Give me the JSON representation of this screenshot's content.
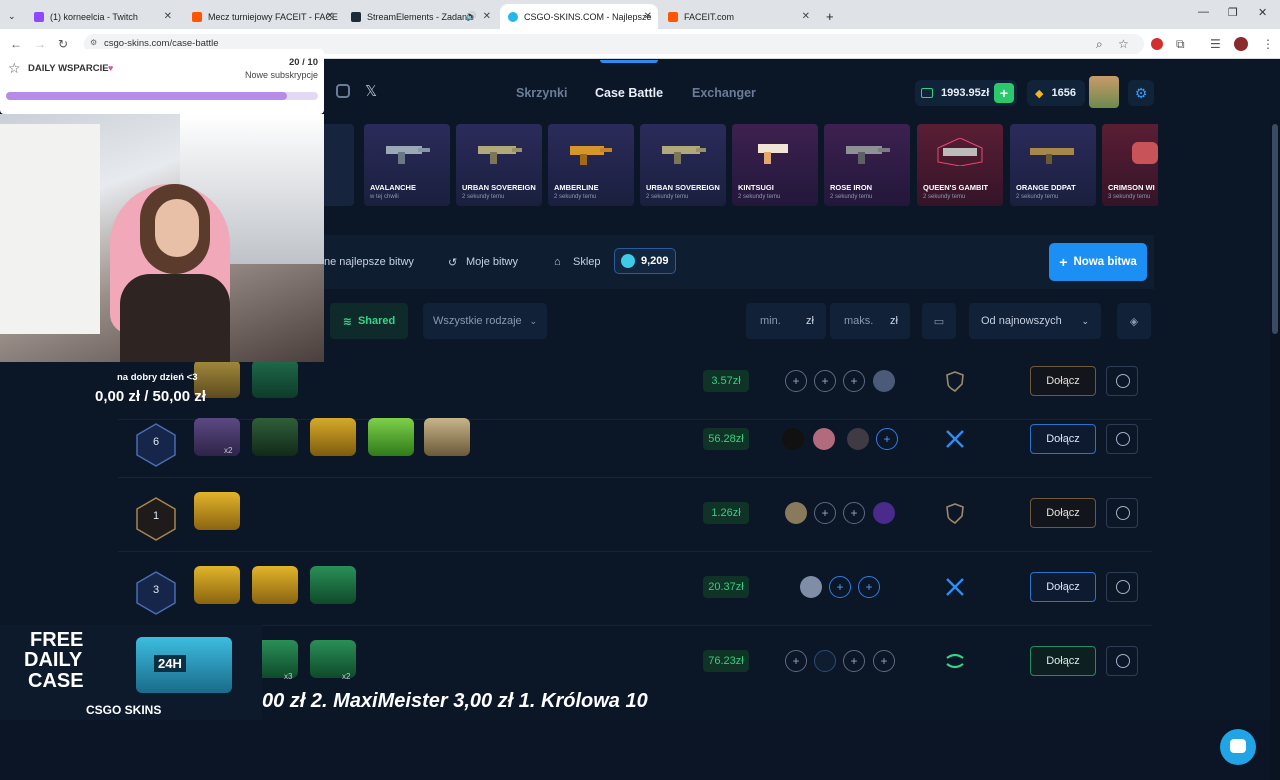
{
  "browser": {
    "tabs": [
      {
        "title": "(1) korneelcia - Twitch",
        "active": false
      },
      {
        "title": "Mecz turniejowy FACEIT - FACE",
        "active": false
      },
      {
        "title": "StreamElements - Zadanie",
        "active": false
      },
      {
        "title": "CSGO-SKINS.COM - Najlepsze",
        "active": true
      },
      {
        "title": "FACEIT.com",
        "active": false
      }
    ],
    "url": "csgo-skins.com/case-battle"
  },
  "header": {
    "nav": [
      "Skrzynki",
      "Case Battle",
      "Exchanger"
    ],
    "balance": "1993.95zł",
    "coins": "1656"
  },
  "drops": [
    {
      "name": "",
      "time": ""
    },
    {
      "name": "AVALANCHE",
      "time": "w tej chwili"
    },
    {
      "name": "URBAN SOVEREIGN",
      "time": "2 sekundy temu"
    },
    {
      "name": "AMBERLINE",
      "time": "2 sekundy temu"
    },
    {
      "name": "URBAN SOVEREIGN",
      "time": "2 sekundy temu"
    },
    {
      "name": "KINTSUGI",
      "time": "2 sekundy temu"
    },
    {
      "name": "ROSE IRON",
      "time": "2 sekundy temu"
    },
    {
      "name": "QUEEN'S GAMBIT",
      "time": "2 sekundy temu"
    },
    {
      "name": "ORANGE DDPAT",
      "time": "2 sekundy temu"
    },
    {
      "name": "CRIMSON WI",
      "time": "3 sekundy temu"
    }
  ],
  "toolbar": {
    "best": "ne najlepsze bitwy",
    "mine": "Moje bitwy",
    "shop": "Sklep",
    "gems": "9,209",
    "new_battle": "Nowa bitwa"
  },
  "filters": {
    "shared": "Shared",
    "kinds": "Wszystkie rodzaje",
    "min": "min.",
    "max": "maks.",
    "currency": "zł",
    "sort": "Od najnowszych"
  },
  "battles": [
    {
      "rounds": "",
      "price": "3.57zł",
      "join": "Dołącz"
    },
    {
      "rounds": "6",
      "price": "56.28zł",
      "join": "Dołącz"
    },
    {
      "rounds": "1",
      "price": "1.26zł",
      "join": "Dołącz"
    },
    {
      "rounds": "3",
      "price": "20.37zł",
      "join": "Dołącz"
    },
    {
      "rounds": "",
      "price": "76.23zł",
      "join": "Dołącz"
    }
  ],
  "overlay": {
    "goal_title": "DAILY WSPARCIE",
    "goal_count": "20 / 10",
    "goal_sub": "Nowe subskrypcje",
    "goal_progress": 0.9,
    "chat_title": "na dobry dzień <3",
    "chat_amount": "0,00 zł / 50,00 zł",
    "promo_line1": "FREE",
    "promo_line2": "DAILY",
    "promo_line3": "CASE",
    "promo_brand": "CSGO SKINS",
    "promo_badge": "24H",
    "ticker": "00 zł  2. MaxiMeister 3,00 zł  1. Królowa 10"
  },
  "multipliers": [
    "x2",
    "x3",
    "x2"
  ]
}
